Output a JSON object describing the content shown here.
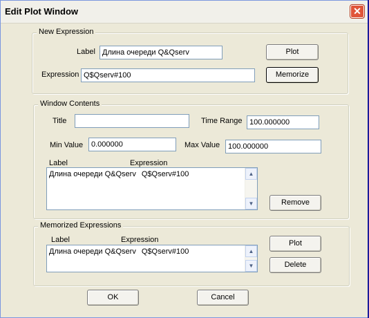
{
  "window": {
    "title": "Edit Plot Window",
    "close_icon": "✕"
  },
  "new_expression": {
    "group_label": "New Expression",
    "label_caption": "Label",
    "label_value": "Длина очереди Q&Qserv",
    "expression_caption": "Expression",
    "expression_value": "Q$Qserv#100",
    "plot_button": "Plot",
    "memorize_button": "Memorize"
  },
  "window_contents": {
    "group_label": "Window Contents",
    "title_caption": "Title",
    "title_value": "",
    "time_range_caption": "Time Range",
    "time_range_value": "100.000000",
    "min_value_caption": "Min Value",
    "min_value_value": "0.000000",
    "max_value_caption": "Max Value",
    "max_value_value": "100.000000",
    "col_label": "Label",
    "col_expression": "Expression",
    "rows": [
      {
        "label": "Длина очереди Q&Qserv",
        "expression": "Q$Qserv#100"
      }
    ],
    "remove_button": "Remove"
  },
  "memorized": {
    "group_label": "Memorized Expressions",
    "col_label": "Label",
    "col_expression": "Expression",
    "rows": [
      {
        "label": "Длина очереди Q&Qserv",
        "expression": "Q$Qserv#100"
      }
    ],
    "plot_button": "Plot",
    "delete_button": "Delete"
  },
  "footer": {
    "ok_button": "OK",
    "cancel_button": "Cancel"
  },
  "icons": {
    "scroll_up": "▲",
    "scroll_down": "▼"
  }
}
